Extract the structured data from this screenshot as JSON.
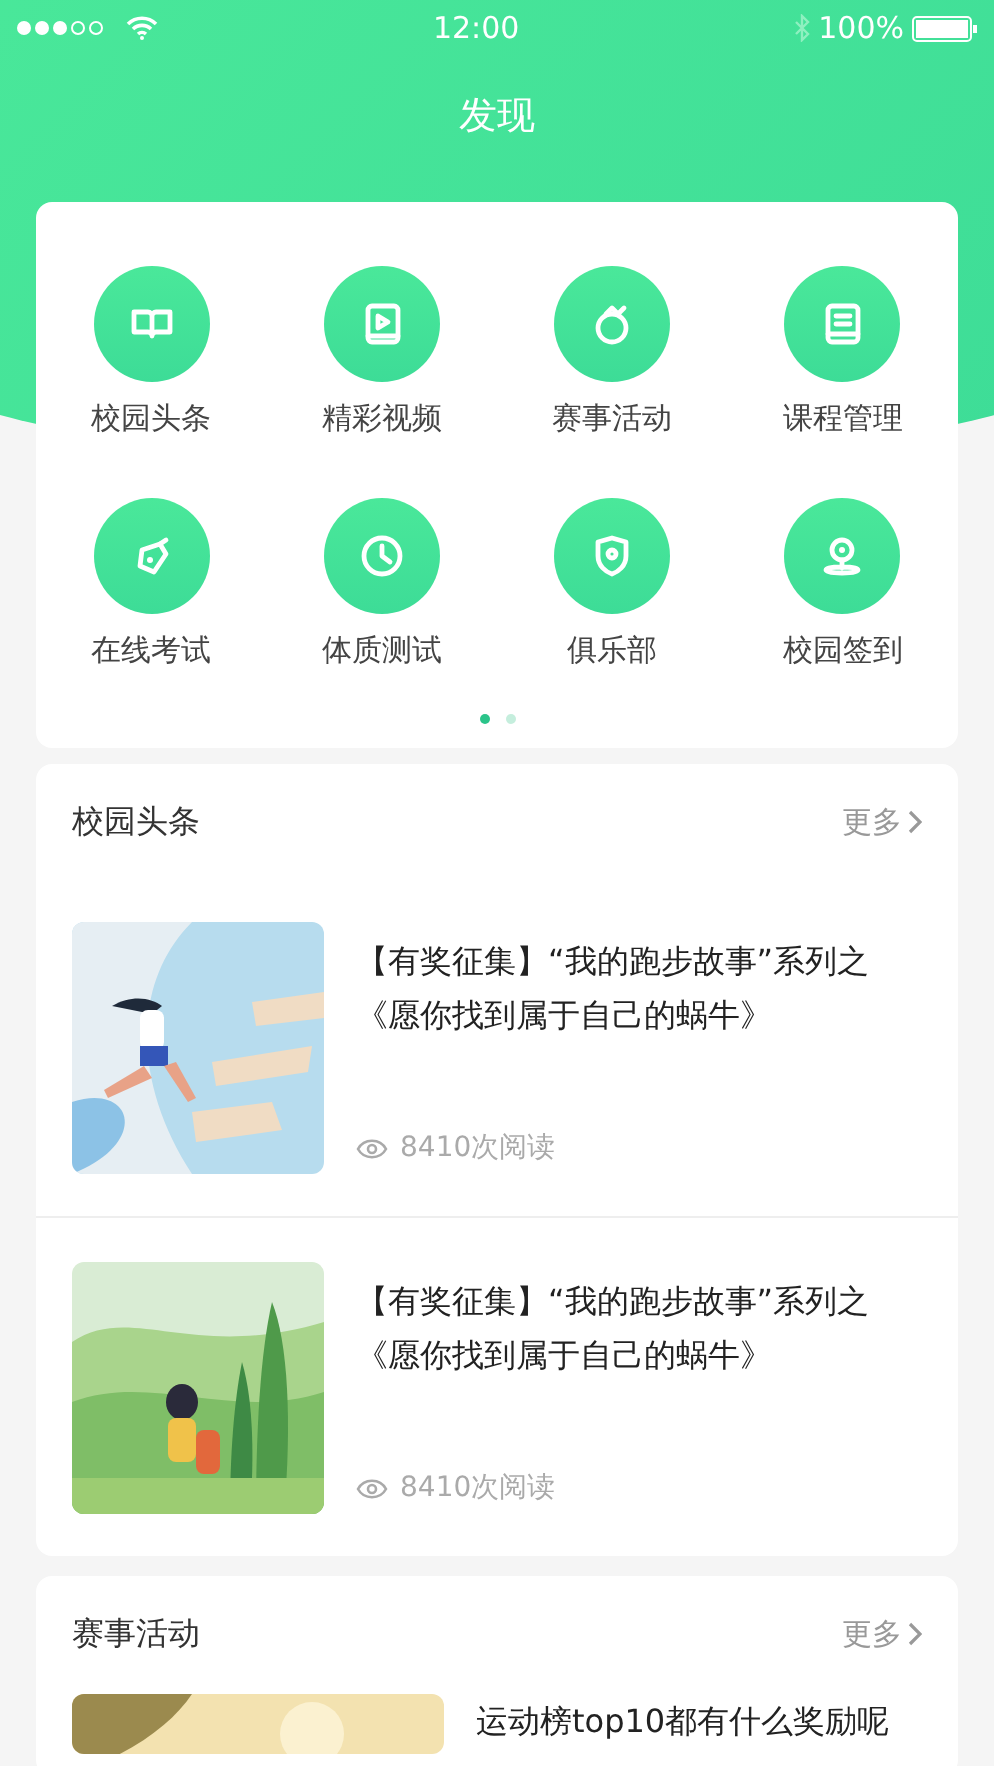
{
  "status_bar": {
    "time": "12:00",
    "battery": "100%"
  },
  "title": "发现",
  "shortcuts": [
    {
      "label": "校园头条",
      "kind": "book"
    },
    {
      "label": "精彩视频",
      "kind": "video"
    },
    {
      "label": "赛事活动",
      "kind": "medal"
    },
    {
      "label": "课程管理",
      "kind": "notebook"
    },
    {
      "label": "在线考试",
      "kind": "pen"
    },
    {
      "label": "体质测试",
      "kind": "clock"
    },
    {
      "label": "俱乐部",
      "kind": "shield"
    },
    {
      "label": "校园签到",
      "kind": "location"
    }
  ],
  "pager": [
    {
      "selected": true
    },
    {
      "selected": false
    }
  ],
  "news": {
    "title": "校园头条",
    "more": "更多",
    "articles": [
      {
        "title": "【有奖征集】“我的跑步故事”系列之《愿你找到属于自己的蜗牛》",
        "reads": "8410次阅读"
      },
      {
        "title": "【有奖征集】“我的跑步故事”系列之《愿你找到属于自己的蜗牛》",
        "reads": "8410次阅读"
      }
    ]
  },
  "events": {
    "title": "赛事活动",
    "more": "更多",
    "items": [
      {
        "title": "运动榜top10都有什么奖励呢"
      }
    ]
  }
}
